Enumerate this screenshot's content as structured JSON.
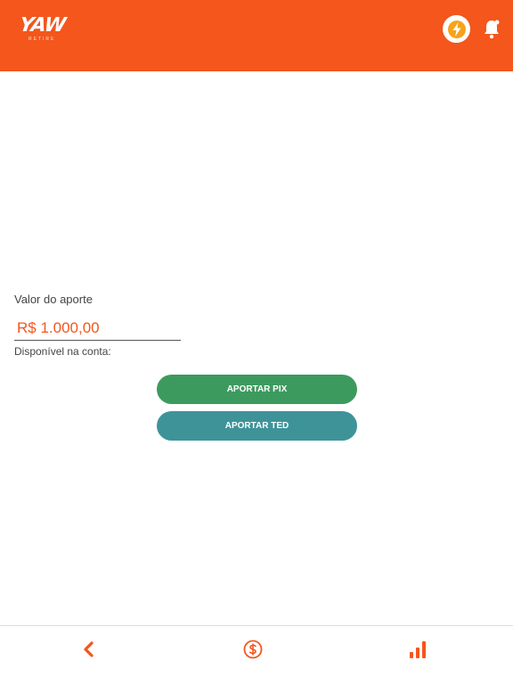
{
  "header": {
    "logo_text": "YAW",
    "logo_subtext": "RETIRE",
    "brand_color": "#f4561c",
    "icons": [
      "lightning-icon",
      "bell-icon"
    ]
  },
  "form": {
    "amount_label": "Valor do aporte",
    "amount_value": "R$ 1.000,00",
    "available_label": "Disponível na conta:"
  },
  "actions": {
    "pix_label": "APORTAR PIX",
    "ted_label": "APORTAR TED",
    "pix_color": "#3d9a5e",
    "ted_color": "#3e9399"
  },
  "bottom_nav": {
    "icons": [
      "chevron-left-icon",
      "dollar-circle-icon",
      "bar-chart-icon"
    ]
  }
}
